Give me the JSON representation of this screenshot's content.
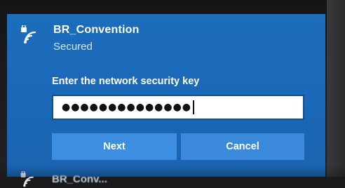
{
  "network": {
    "name": "BR_Convention",
    "status": "Secured",
    "icon": "wifi-secured-icon"
  },
  "prompt": {
    "label": "Enter the network security key"
  },
  "key_input": {
    "value": "●●●●●●●●●●●●●●"
  },
  "buttons": {
    "next_label": "Next",
    "cancel_label": "Cancel"
  },
  "next_network": {
    "name": "BR_Conv..."
  },
  "colors": {
    "panel": "#1d6dbd",
    "button": "#3d8ee0",
    "text": "#ffffff"
  }
}
